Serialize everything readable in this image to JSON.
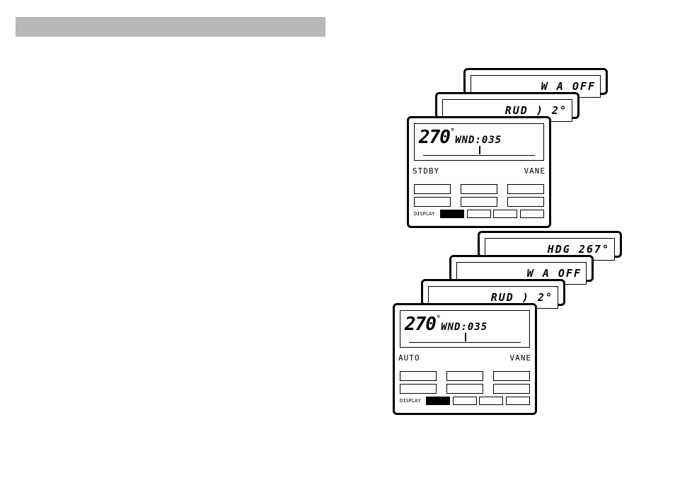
{
  "graybar": "",
  "stack1": {
    "back2": "W A OFF",
    "back1": "RUD ) 2°",
    "front": {
      "heading": "270",
      "aux": "WND:035",
      "left": "STDBY",
      "right": "VANE"
    }
  },
  "stack2": {
    "back3": "HDG 267°",
    "back2": "W A OFF",
    "back1": "RUD ) 2°",
    "front": {
      "heading": "270",
      "aux": "WND:035",
      "left": "AUTO",
      "right": "VANE"
    }
  },
  "labels": {
    "display": "DISPLAY"
  }
}
